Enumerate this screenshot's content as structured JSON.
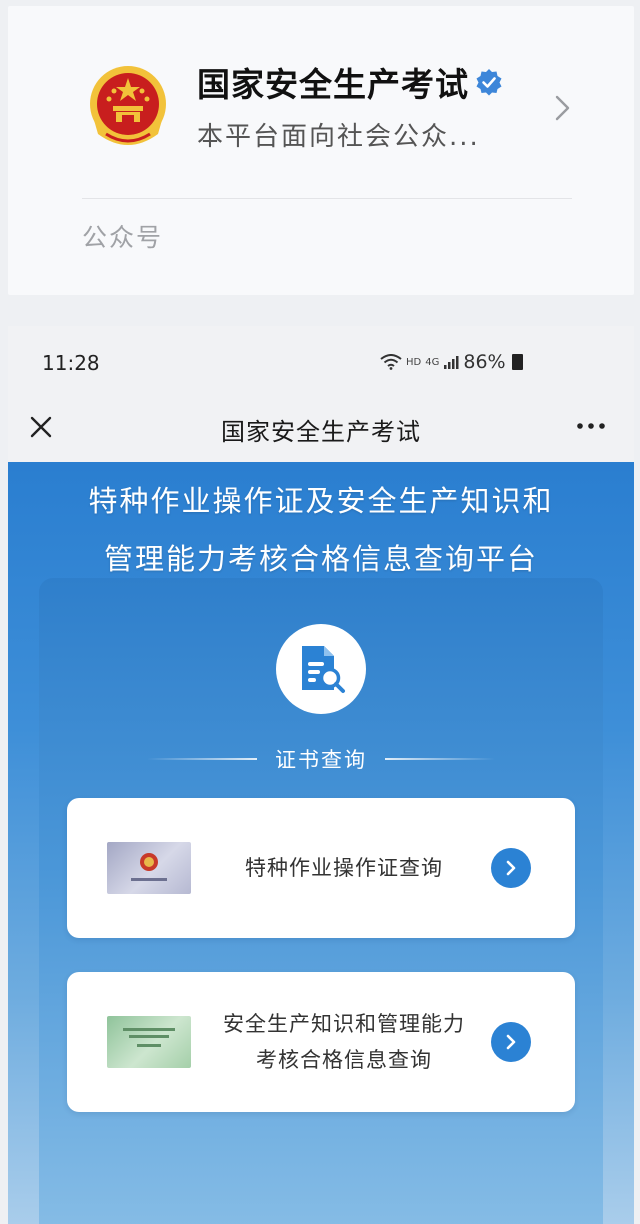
{
  "account_card": {
    "name": "国家安全生产考试",
    "description": "本平台面向社会公众...",
    "type_label": "公众号"
  },
  "status_bar": {
    "time": "11:28",
    "network_label": "HD",
    "signal_label": "4G",
    "battery": "86%"
  },
  "title_bar": {
    "title": "国家安全生产考试"
  },
  "page": {
    "heading_line1": "特种作业操作证及安全生产知识和",
    "heading_line2": "管理能力考核合格信息查询平台",
    "section_title": "证书查询",
    "cards": [
      {
        "label": "特种作业操作证查询"
      },
      {
        "label_line1": "安全生产知识和管理能力",
        "label_line2": "考核合格信息查询"
      }
    ]
  },
  "icons": [
    "national-emblem-icon",
    "verified-icon",
    "chevron-right-icon",
    "wifi-icon",
    "signal-icon",
    "battery-icon",
    "close-icon",
    "more-icon",
    "document-search-icon",
    "arrow-right-icon"
  ],
  "colors": {
    "accent_blue": "#2b82d4",
    "verified_blue": "#3d86d9",
    "emblem_red": "#c81e1e",
    "emblem_gold": "#f2c23a"
  }
}
